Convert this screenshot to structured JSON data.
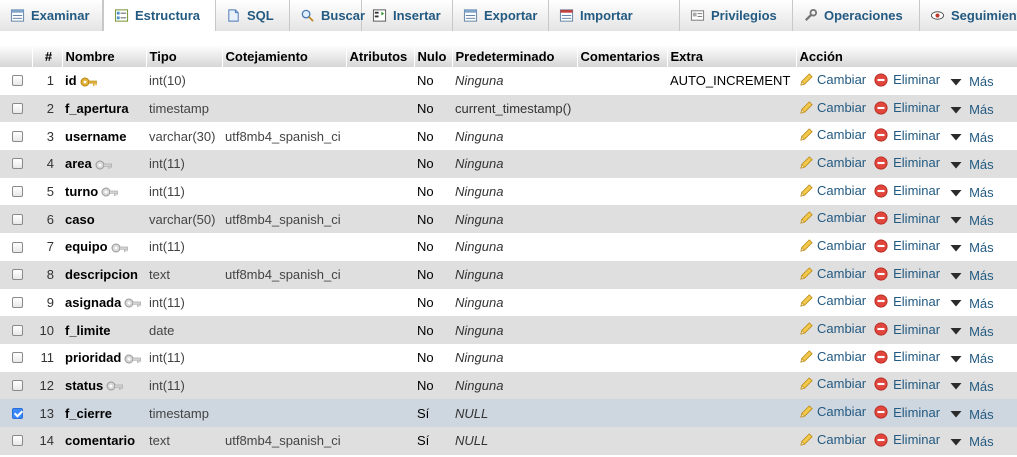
{
  "tabs": [
    {
      "label": "Examinar",
      "icon": "browse-icon",
      "active": false
    },
    {
      "label": "Estructura",
      "icon": "structure-icon",
      "active": true
    },
    {
      "label": "SQL",
      "icon": "sql-icon",
      "active": false
    },
    {
      "label": "Buscar",
      "icon": "search-icon",
      "active": false
    },
    {
      "label": "Insertar",
      "icon": "insert-icon",
      "active": false
    },
    {
      "label": "Exportar",
      "icon": "export-icon",
      "active": false
    },
    {
      "label": "Importar",
      "icon": "import-icon",
      "active": false
    },
    {
      "label": "Privilegios",
      "icon": "privileges-icon",
      "active": false
    },
    {
      "label": "Operaciones",
      "icon": "operations-icon",
      "active": false
    },
    {
      "label": "Seguimiento",
      "icon": "tracking-icon",
      "active": false
    }
  ],
  "table": {
    "headers": {
      "num": "#",
      "name": "Nombre",
      "type": "Tipo",
      "collation": "Cotejamiento",
      "attributes": "Atributos",
      "null": "Nulo",
      "default": "Predeterminado",
      "comments": "Comentarios",
      "extra": "Extra",
      "action": "Acción"
    },
    "actions": {
      "change": "Cambiar",
      "drop": "Eliminar",
      "more": "Más"
    },
    "rows": [
      {
        "num": "1",
        "name": "id",
        "key": "primary",
        "type": "int(10)",
        "collation": "",
        "attributes": "",
        "null": "No",
        "default": "Ninguna",
        "default_italic": true,
        "comments": "",
        "extra": "AUTO_INCREMENT",
        "checked": false
      },
      {
        "num": "2",
        "name": "f_apertura",
        "key": "",
        "type": "timestamp",
        "collation": "",
        "attributes": "",
        "null": "No",
        "default": "current_timestamp()",
        "default_italic": false,
        "comments": "",
        "extra": "",
        "checked": false
      },
      {
        "num": "3",
        "name": "username",
        "key": "",
        "type": "varchar(30)",
        "collation": "utf8mb4_spanish_ci",
        "attributes": "",
        "null": "No",
        "default": "Ninguna",
        "default_italic": true,
        "comments": "",
        "extra": "",
        "checked": false
      },
      {
        "num": "4",
        "name": "area",
        "key": "index",
        "type": "int(11)",
        "collation": "",
        "attributes": "",
        "null": "No",
        "default": "Ninguna",
        "default_italic": true,
        "comments": "",
        "extra": "",
        "checked": false
      },
      {
        "num": "5",
        "name": "turno",
        "key": "index",
        "type": "int(11)",
        "collation": "",
        "attributes": "",
        "null": "No",
        "default": "Ninguna",
        "default_italic": true,
        "comments": "",
        "extra": "",
        "checked": false
      },
      {
        "num": "6",
        "name": "caso",
        "key": "",
        "type": "varchar(50)",
        "collation": "utf8mb4_spanish_ci",
        "attributes": "",
        "null": "No",
        "default": "Ninguna",
        "default_italic": true,
        "comments": "",
        "extra": "",
        "checked": false
      },
      {
        "num": "7",
        "name": "equipo",
        "key": "index",
        "type": "int(11)",
        "collation": "",
        "attributes": "",
        "null": "No",
        "default": "Ninguna",
        "default_italic": true,
        "comments": "",
        "extra": "",
        "checked": false
      },
      {
        "num": "8",
        "name": "descripcion",
        "key": "",
        "type": "text",
        "collation": "utf8mb4_spanish_ci",
        "attributes": "",
        "null": "No",
        "default": "Ninguna",
        "default_italic": true,
        "comments": "",
        "extra": "",
        "checked": false
      },
      {
        "num": "9",
        "name": "asignada",
        "key": "index",
        "type": "int(11)",
        "collation": "",
        "attributes": "",
        "null": "No",
        "default": "Ninguna",
        "default_italic": true,
        "comments": "",
        "extra": "",
        "checked": false
      },
      {
        "num": "10",
        "name": "f_limite",
        "key": "",
        "type": "date",
        "collation": "",
        "attributes": "",
        "null": "No",
        "default": "Ninguna",
        "default_italic": true,
        "comments": "",
        "extra": "",
        "checked": false
      },
      {
        "num": "11",
        "name": "prioridad",
        "key": "index",
        "type": "int(11)",
        "collation": "",
        "attributes": "",
        "null": "No",
        "default": "Ninguna",
        "default_italic": true,
        "comments": "",
        "extra": "",
        "checked": false
      },
      {
        "num": "12",
        "name": "status",
        "key": "index",
        "type": "int(11)",
        "collation": "",
        "attributes": "",
        "null": "No",
        "default": "Ninguna",
        "default_italic": true,
        "comments": "",
        "extra": "",
        "checked": false
      },
      {
        "num": "13",
        "name": "f_cierre",
        "key": "",
        "type": "timestamp",
        "collation": "",
        "attributes": "",
        "null": "Sí",
        "default": "NULL",
        "default_italic": true,
        "comments": "",
        "extra": "",
        "checked": true
      },
      {
        "num": "14",
        "name": "comentario",
        "key": "",
        "type": "text",
        "collation": "utf8mb4_spanish_ci",
        "attributes": "",
        "null": "Sí",
        "default": "NULL",
        "default_italic": true,
        "comments": "",
        "extra": "",
        "checked": false
      }
    ]
  },
  "colors": {
    "link": "#235a81",
    "row_even": "#dfdfdf",
    "row_selected": "#ced6df",
    "drop_icon": "#e0463c",
    "key_primary": "#e2b13c",
    "key_index": "#aaaaaa"
  }
}
